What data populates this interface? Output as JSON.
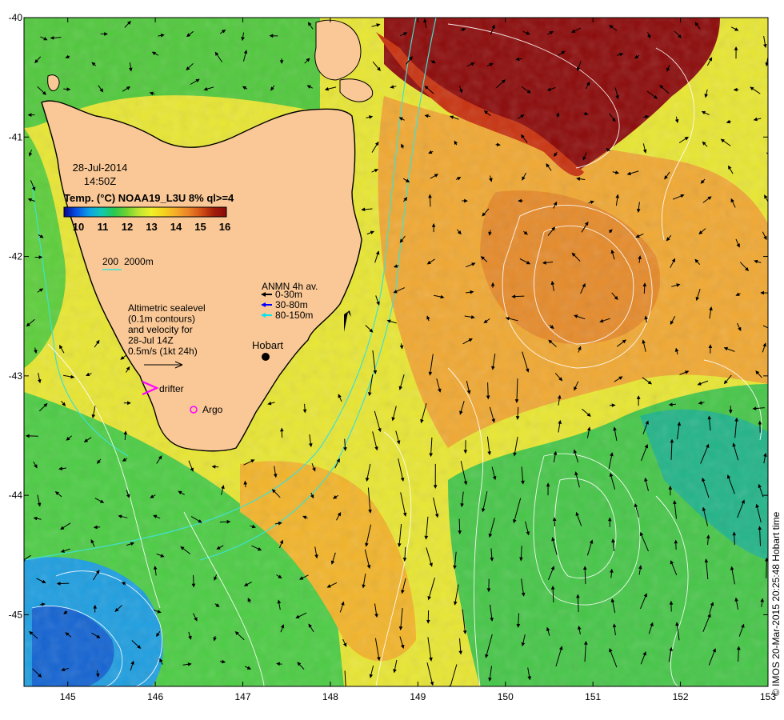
{
  "map": {
    "lon_range": [
      144.5,
      153.0
    ],
    "lat_range": [
      -45.6,
      -40.0
    ],
    "x_ticks": [
      "145",
      "146",
      "147",
      "148",
      "149",
      "150",
      "151",
      "152",
      "153"
    ],
    "y_ticks": [
      "-40",
      "-41",
      "-42",
      "-43",
      "-44",
      "-45"
    ],
    "x_tick_values": [
      145,
      146,
      147,
      148,
      149,
      150,
      151,
      152,
      153
    ],
    "y_tick_values": [
      -40,
      -41,
      -42,
      -43,
      -44,
      -45
    ]
  },
  "header": {
    "date": "28-Jul-2014",
    "time": "14:50Z",
    "product_label": "Temp. (°C) NOAA19_L3U 8% ql>=4"
  },
  "colorbar": {
    "ticks": [
      "10",
      "11",
      "12",
      "13",
      "14",
      "15",
      "16"
    ],
    "colors": [
      "#08088c",
      "#0850e6",
      "#0aa0e6",
      "#12c8b4",
      "#28c850",
      "#6ed232",
      "#bee632",
      "#f0f028",
      "#f5d21e",
      "#f5aa28",
      "#ea8228",
      "#d24f14",
      "#a01e0a",
      "#8c0a0a"
    ]
  },
  "bathymetry_legend": {
    "label_200": "200",
    "label_2000": "2000m"
  },
  "anmn_legend": {
    "title": "ANMN 4h av.",
    "items": [
      {
        "label": "0-30m",
        "color": "#000000"
      },
      {
        "label": "30-80m",
        "color": "#0000ff"
      },
      {
        "label": "80-150m",
        "color": "#00e5ee"
      }
    ]
  },
  "altimetry_legend": {
    "lines": [
      "Altimetric sealevel",
      "(0.1m contours)",
      "and velocity for",
      "28-Jul 14Z",
      "0.5m/s (1kt 24h)"
    ]
  },
  "markers": {
    "hobart": "Hobart",
    "drifter": "drifter",
    "argo": "Argo"
  },
  "credit": "© IMOS 20-Mar-2015 20:25:48 Hobart time",
  "palette": {
    "land": "#fac896",
    "sst_cold": "#0a8ce6",
    "sst_green": "#28c850",
    "sst_yellow": "#f0f028",
    "sst_orange": "#f0a028",
    "sst_warm": "#8c0a0a",
    "contour": "#ffffff",
    "isobath": "#40e0d0",
    "drifter": "#ff00ff",
    "argo": "#ff00ff"
  }
}
